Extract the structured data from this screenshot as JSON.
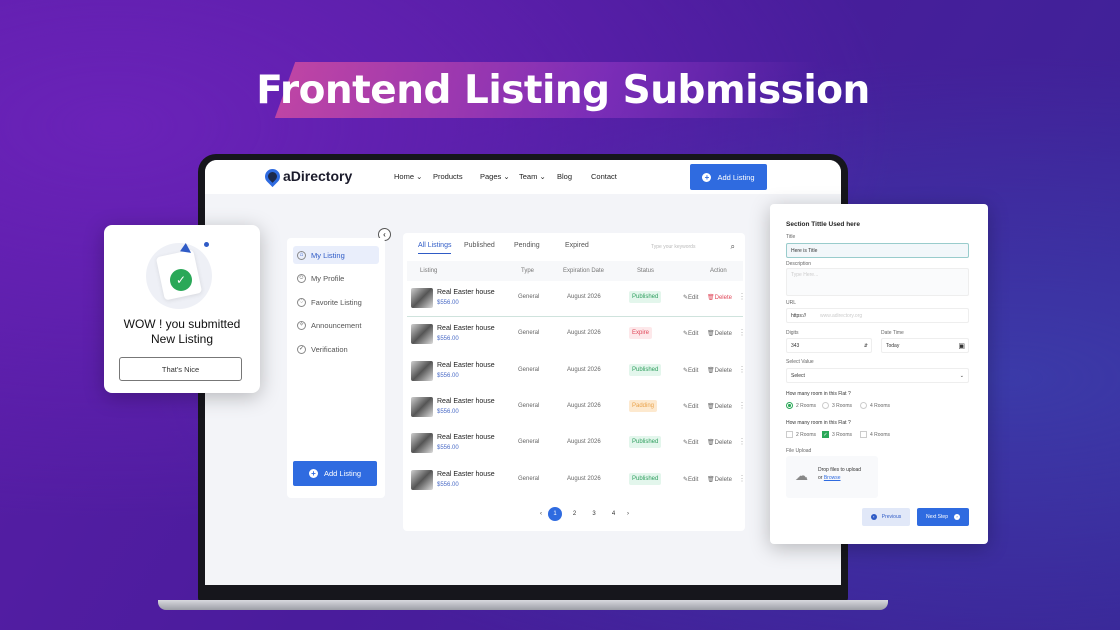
{
  "banner": {
    "title": "Frontend Listing Submission"
  },
  "header": {
    "logo": "aDirectory",
    "nav": [
      "Home",
      "Products",
      "Pages",
      "Team",
      "Blog",
      "Contact"
    ],
    "nav_dropdown": [
      true,
      false,
      true,
      true,
      false,
      false
    ],
    "add_listing": "Add Listing"
  },
  "sidebar": {
    "items": [
      {
        "label": "My Listing",
        "icon": "home-icon"
      },
      {
        "label": "My Profile",
        "icon": "user-icon"
      },
      {
        "label": "Favorite Listing",
        "icon": "heart-icon"
      },
      {
        "label": "Announcement",
        "icon": "megaphone-icon"
      },
      {
        "label": "Verification",
        "icon": "check-circle-icon"
      }
    ],
    "active": 0,
    "add_listing": "Add Listing"
  },
  "main": {
    "tabs": [
      "All Listings",
      "Published",
      "Pending",
      "Expired"
    ],
    "search_placeholder": "Type your keywords",
    "columns": [
      "Listing",
      "Type",
      "Expiration Date",
      "Status",
      "Action"
    ],
    "rows": [
      {
        "name": "Real Easter house",
        "price": "$556.00",
        "type": "General",
        "date": "August 2026",
        "status": "Published"
      },
      {
        "name": "Real Easter house",
        "price": "$556.00",
        "type": "General",
        "date": "August 2026",
        "status": "Expire"
      },
      {
        "name": "Real Easter house",
        "price": "$556.00",
        "type": "General",
        "date": "August 2026",
        "status": "Published"
      },
      {
        "name": "Real Easter house",
        "price": "$556.00",
        "type": "General",
        "date": "August 2026",
        "status": "Padding"
      },
      {
        "name": "Real Easter house",
        "price": "$556.00",
        "type": "General",
        "date": "August 2026",
        "status": "Published"
      },
      {
        "name": "Real Easter house",
        "price": "$556.00",
        "type": "General",
        "date": "August 2026",
        "status": "Published"
      }
    ],
    "edit": "Edit",
    "delete": "Delete",
    "pages": [
      "1",
      "2",
      "3",
      "4"
    ],
    "current_page": "1"
  },
  "status_colors": {
    "Published": [
      "#e3f6ec",
      "#2e9e5e"
    ],
    "Expire": [
      "#fde8ea",
      "#e0485a"
    ],
    "Padding": [
      "#fde9cf",
      "#e9a24a"
    ]
  },
  "form": {
    "section_title": "Section Tittle Used here",
    "title_label": "Title",
    "title_value": "Here is Title",
    "description_label": "Description",
    "description_placeholder": "Type Here...",
    "url_label": "URL",
    "url_prefix": "https://",
    "url_placeholder": "www.adirectory.org",
    "digits_label": "Digits",
    "digits_value": "343",
    "date_label": "Date Time",
    "date_value": "Today",
    "select_label": "Select Value",
    "select_value": "Select",
    "radio_question": "How many room in this Flat ?",
    "radio_options": [
      "2 Rooms",
      "3 Rooms",
      "4 Rooms"
    ],
    "radio_selected": 0,
    "checkbox_question": "How many room in this Flat ?",
    "checkbox_options": [
      "2 Rooms",
      "3 Rooms",
      "4 Rooms"
    ],
    "checkbox_checked": 1,
    "file_label": "File Upload",
    "drop_text": "Drop files to upload",
    "or_text": "or",
    "browse": "Browse",
    "previous": "Previous",
    "next": "Next Step"
  },
  "popup": {
    "message_line1": "WOW ! you submitted",
    "message_line2": "New Listing",
    "button": "That's Nice"
  },
  "colors": {
    "accent": "#2f6be0",
    "background": "#4a1c9c"
  }
}
